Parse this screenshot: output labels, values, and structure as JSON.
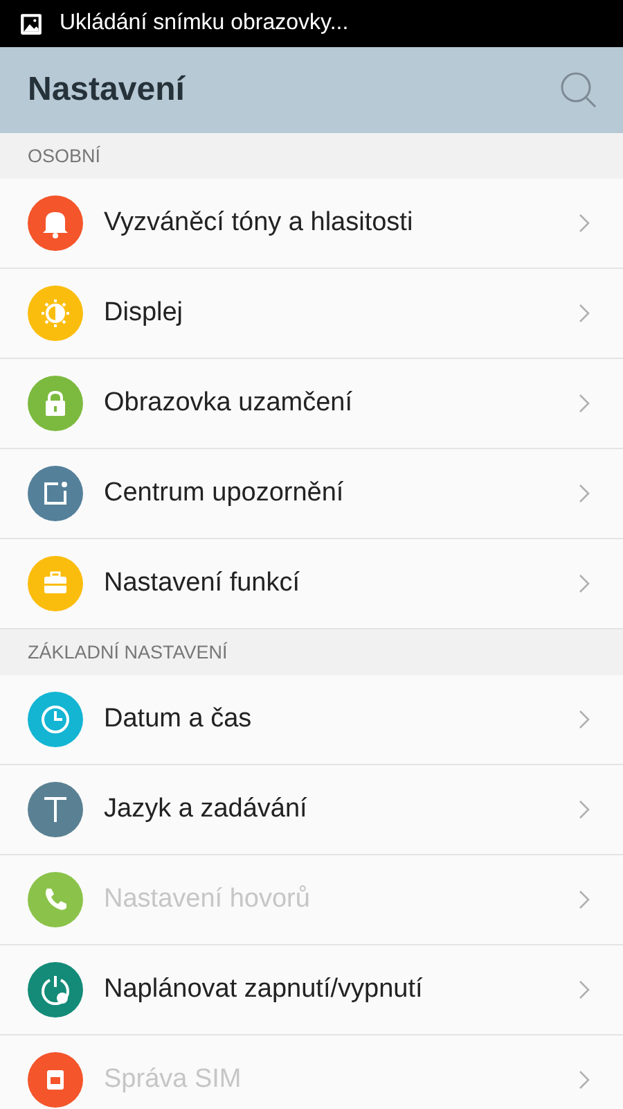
{
  "status_bar": {
    "notification": "Ukládání snímku obrazovky..."
  },
  "header": {
    "title": "Nastavení"
  },
  "sections": [
    {
      "title": "OSOBNÍ",
      "items": [
        {
          "label": "Vyzváněcí tóny a hlasitosti",
          "kind": "bell",
          "color": "#f4552b",
          "disabled": false
        },
        {
          "label": "Displej",
          "kind": "brightness",
          "color": "#fbbd0d",
          "disabled": false
        },
        {
          "label": "Obrazovka uzamčení",
          "kind": "lock",
          "color": "#7cba3f",
          "disabled": false
        },
        {
          "label": "Centrum upozornění",
          "kind": "notification",
          "color": "#54809a",
          "disabled": false
        },
        {
          "label": "Nastavení funkcí",
          "kind": "toolbox",
          "color": "#fbbd0d",
          "disabled": false
        }
      ]
    },
    {
      "title": "ZÁKLADNÍ NASTAVENÍ",
      "items": [
        {
          "label": "Datum a čas",
          "kind": "clock",
          "color": "#13b5d3",
          "disabled": false
        },
        {
          "label": "Jazyk a zadávání",
          "kind": "letter",
          "color": "#5a8193",
          "disabled": false
        },
        {
          "label": "Nastavení hovorů",
          "kind": "phone",
          "color": "#8bc34a",
          "disabled": true
        },
        {
          "label": "Naplánovat zapnutí/vypnutí",
          "kind": "power",
          "color": "#138b78",
          "disabled": false
        },
        {
          "label": "Správa SIM",
          "kind": "sim",
          "color": "#f4552b",
          "disabled": true
        }
      ]
    }
  ]
}
